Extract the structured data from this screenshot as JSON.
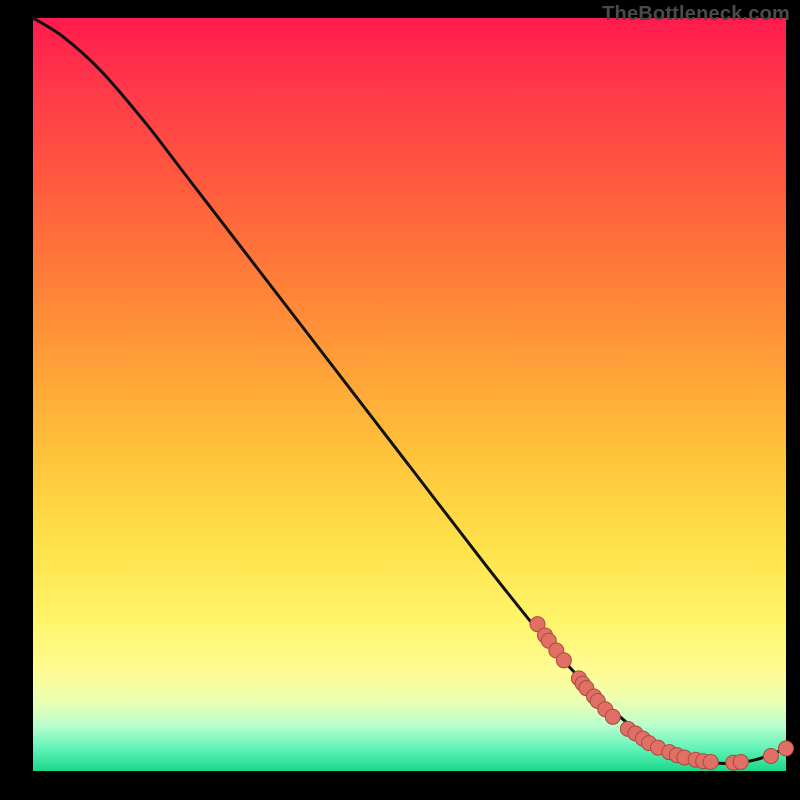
{
  "watermark": "TheBottleneck.com",
  "chart_data": {
    "type": "line",
    "title": "",
    "xlabel": "",
    "ylabel": "",
    "xlim": [
      0,
      100
    ],
    "ylim": [
      0,
      100
    ],
    "curve": [
      {
        "x": 0,
        "y": 100
      },
      {
        "x": 4,
        "y": 97.5
      },
      {
        "x": 9,
        "y": 93
      },
      {
        "x": 15,
        "y": 86
      },
      {
        "x": 20,
        "y": 79.5
      },
      {
        "x": 30,
        "y": 66.5
      },
      {
        "x": 40,
        "y": 53.5
      },
      {
        "x": 50,
        "y": 40.5
      },
      {
        "x": 60,
        "y": 27.5
      },
      {
        "x": 68,
        "y": 17.5
      },
      {
        "x": 72,
        "y": 13
      },
      {
        "x": 76,
        "y": 9
      },
      {
        "x": 80,
        "y": 5.5
      },
      {
        "x": 84,
        "y": 3
      },
      {
        "x": 88,
        "y": 1.5
      },
      {
        "x": 92,
        "y": 1
      },
      {
        "x": 96,
        "y": 1.5
      },
      {
        "x": 100,
        "y": 3
      }
    ],
    "points": [
      {
        "x": 67,
        "y": 19.5
      },
      {
        "x": 68,
        "y": 18
      },
      {
        "x": 68.5,
        "y": 17.3
      },
      {
        "x": 69.5,
        "y": 16
      },
      {
        "x": 70.5,
        "y": 14.7
      },
      {
        "x": 72.5,
        "y": 12.3
      },
      {
        "x": 73,
        "y": 11.6
      },
      {
        "x": 73.5,
        "y": 11
      },
      {
        "x": 74.5,
        "y": 9.9
      },
      {
        "x": 75,
        "y": 9.3
      },
      {
        "x": 76,
        "y": 8.2
      },
      {
        "x": 77,
        "y": 7.2
      },
      {
        "x": 79,
        "y": 5.6
      },
      {
        "x": 80,
        "y": 5
      },
      {
        "x": 81,
        "y": 4.3
      },
      {
        "x": 81.8,
        "y": 3.7
      },
      {
        "x": 83,
        "y": 3.1
      },
      {
        "x": 84.5,
        "y": 2.5
      },
      {
        "x": 85.5,
        "y": 2.1
      },
      {
        "x": 86.5,
        "y": 1.8
      },
      {
        "x": 88,
        "y": 1.5
      },
      {
        "x": 89,
        "y": 1.3
      },
      {
        "x": 90,
        "y": 1.2
      },
      {
        "x": 93,
        "y": 1.1
      },
      {
        "x": 94,
        "y": 1.2
      },
      {
        "x": 98,
        "y": 2
      },
      {
        "x": 100,
        "y": 3
      }
    ],
    "colors": {
      "curve": "#111111",
      "point_fill": "#e07066",
      "point_stroke": "#b0483e"
    }
  }
}
